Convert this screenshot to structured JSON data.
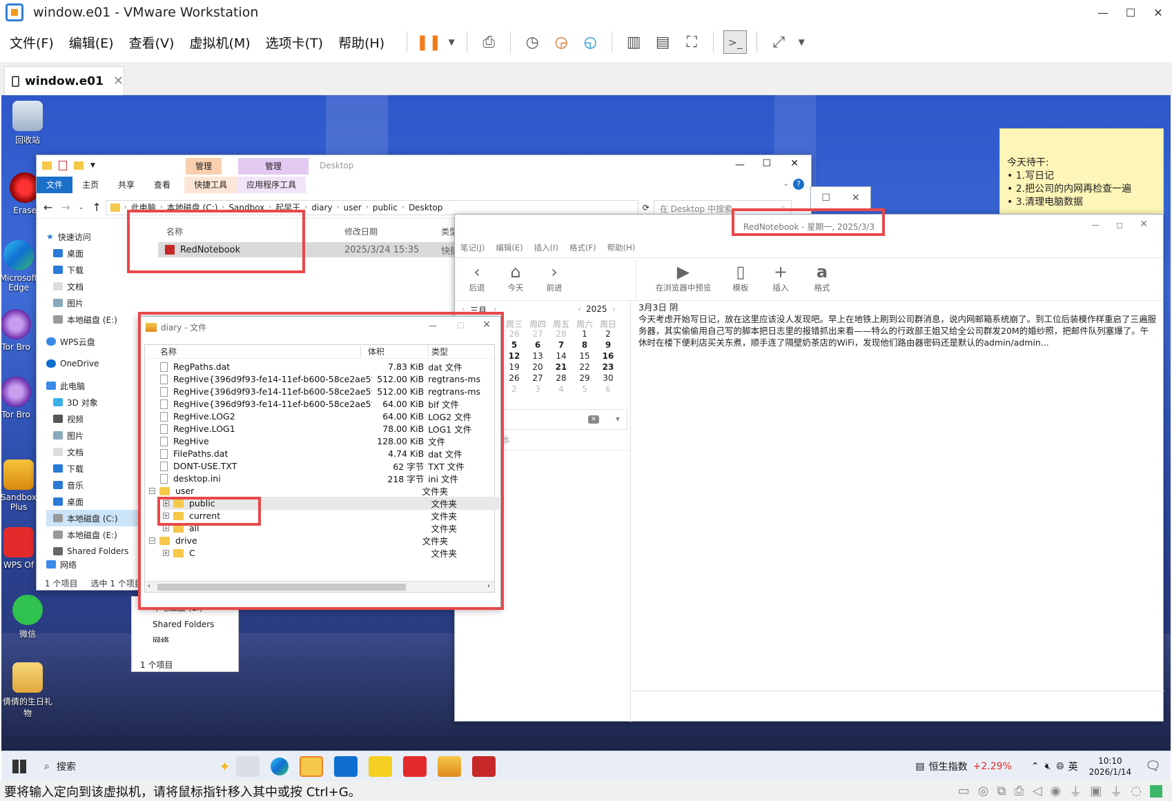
{
  "vm": {
    "title": "window.e01 - VMware Workstation",
    "menu": [
      "文件(F)",
      "编辑(E)",
      "查看(V)",
      "虚拟机(M)",
      "选项卡(T)",
      "帮助(H)"
    ],
    "tab_label": "window.e01",
    "status_text": "要将输入定向到该虚拟机，请将鼠标指针移入其中或按 Ctrl+G。"
  },
  "desktop": {
    "icons": [
      "回收站",
      "Erase",
      "Microsoft Edge",
      "Tor Bro",
      "Tor Bro",
      "Sandbox Plus",
      "WPS Of",
      "微信",
      "倩倩的生日礼物"
    ]
  },
  "sticky": {
    "title": "今天待干:",
    "items": [
      "• 1.写日记",
      "• 2.把公司的内网再检查一遍",
      "• 3.清理电脑数据"
    ]
  },
  "explorer": {
    "ribbon_tabs": [
      "文件",
      "主页",
      "共享",
      "查看",
      "快捷工具",
      "应用程序工具"
    ],
    "context_tabs": [
      "管理",
      "管理"
    ],
    "context_title": "Desktop",
    "breadcrumb": [
      "此电脑",
      "本地磁盘 (C:)",
      "Sandbox",
      "起早王",
      "diary",
      "user",
      "public",
      "Desktop"
    ],
    "search_placeholder": "在 Desktop 中搜索",
    "col_name": "名称",
    "col_date": "修改日期",
    "col_type": "类型",
    "file_name": "RedNotebook",
    "file_date": "2025/3/24 15:35",
    "file_type": "快捷",
    "nav": [
      "快速访问",
      "桌面",
      "下载",
      "文档",
      "图片",
      "本地磁盘 (E:)",
      "WPS云盘",
      "OneDrive",
      "此电脑",
      "3D 对象",
      "视频",
      "图片",
      "文档",
      "下载",
      "音乐",
      "桌面",
      "本地磁盘 (C:)",
      "本地磁盘 (E:)",
      "Shared Folders",
      "网络"
    ],
    "status": [
      "1 个项目",
      "选中 1 个项目"
    ],
    "nav2": [
      "本地磁盘 (E:)",
      "Shared Folders",
      "网络"
    ],
    "status2": "1 个项目"
  },
  "diary": {
    "title": "diary - 文件",
    "cols": [
      "名称",
      "体积",
      "类型"
    ],
    "files": [
      {
        "name": "RegPaths.dat",
        "size": "7.83 KiB",
        "type": "dat 文件"
      },
      {
        "name": "RegHive{396d9f93-fe14-11ef-b600-58ce2ae5fb...",
        "size": "512.00 KiB",
        "type": "regtrans-ms"
      },
      {
        "name": "RegHive{396d9f93-fe14-11ef-b600-58ce2ae5fb...",
        "size": "512.00 KiB",
        "type": "regtrans-ms"
      },
      {
        "name": "RegHive{396d9f93-fe14-11ef-b600-58ce2ae5fb...",
        "size": "64.00 KiB",
        "type": "blf 文件"
      },
      {
        "name": "RegHive.LOG2",
        "size": "64.00 KiB",
        "type": "LOG2 文件"
      },
      {
        "name": "RegHive.LOG1",
        "size": "78.00 KiB",
        "type": "LOG1 文件"
      },
      {
        "name": "RegHive",
        "size": "128.00 KiB",
        "type": "文件"
      },
      {
        "name": "FilePaths.dat",
        "size": "4.74 KiB",
        "type": "dat 文件"
      },
      {
        "name": "DONT-USE.TXT",
        "size": "62 字节",
        "type": "TXT 文件"
      },
      {
        "name": "desktop.ini",
        "size": "218 字节",
        "type": "ini 文件"
      }
    ],
    "folders": [
      {
        "name": "user",
        "type": "文件夹"
      },
      {
        "name": "public",
        "type": "文件夹"
      },
      {
        "name": "current",
        "type": "文件夹"
      },
      {
        "name": "all",
        "type": "文件夹"
      },
      {
        "name": "drive",
        "type": "文件夹"
      },
      {
        "name": "C",
        "type": "文件夹"
      }
    ]
  },
  "rednotebook": {
    "title": "RedNotebook - 星期一, 2025/3/3",
    "menu": [
      "笔记(J)",
      "编辑(E)",
      "插入(I)",
      "格式(F)",
      "帮助(H)"
    ],
    "toolbar": [
      "后退",
      "今天",
      "前进",
      "在浏览器中预览",
      "模板",
      "插入",
      "格式"
    ],
    "month": "三月",
    "year": "2025",
    "weekdays": [
      "周三",
      "周四",
      "周五",
      "周六",
      "周日"
    ],
    "cal_rows": [
      [
        "26",
        "27",
        "28",
        "1",
        "2"
      ],
      [
        "5",
        "6",
        "7",
        "8",
        "9"
      ],
      [
        "12",
        "13",
        "14",
        "15",
        "16"
      ],
      [
        "19",
        "20",
        "21",
        "22",
        "23"
      ],
      [
        "26",
        "27",
        "28",
        "29",
        "30"
      ],
      [
        "2",
        "3",
        "4",
        "5",
        "6"
      ]
    ],
    "tag_label": "本",
    "entry_date": "3月3日 阴",
    "entry_text": "今天考虑开始写日记，放在这里应该没人发现吧。早上在地铁上刷到公司群消息，说内网邮箱系统崩了。到工位后装模作样重启了三遍服务器，其实偷偷用自己写的脚本把日志里的报错抓出来看——特么的行政部王姐又给全公司群发20M的婚纱照，把邮件队列塞爆了。午休时在楼下便利店买关东煮，顺手连了隔壁奶茶店的WiFi，发现他们路由器密码还是默认的admin/admin..."
  },
  "taskbar": {
    "search": "搜索",
    "stock_name": "恒生指数",
    "stock_change": "+2.29%",
    "ime": "英",
    "time": "10:10",
    "date": "2026/1/14"
  }
}
